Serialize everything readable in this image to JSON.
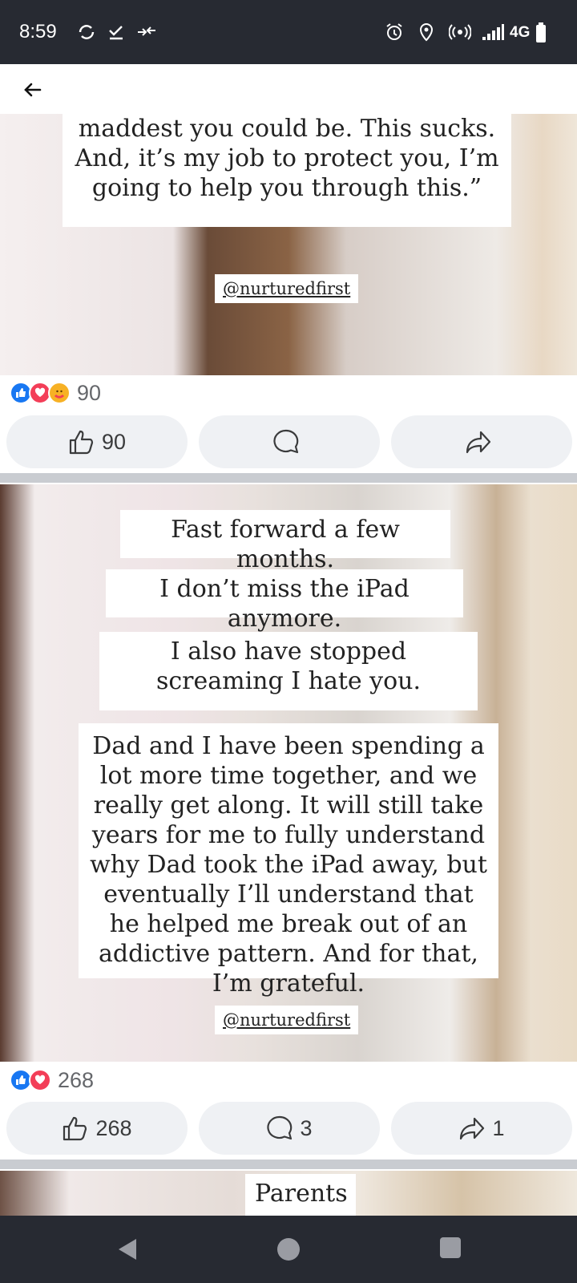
{
  "status": {
    "time": "8:59",
    "network": "4G"
  },
  "post1": {
    "lines": "maddest you could be. This sucks. And, it’s my job to protect you, I’m going to help you through this.”",
    "handle": "@nurturedfirst",
    "reaction_count": "90",
    "like_count": "90",
    "comment_count": "",
    "share_count": ""
  },
  "post2": {
    "box1": "Fast forward a few months.",
    "box2": "I don’t miss the iPad anymore.",
    "box3": "I also have stopped screaming I hate you.",
    "box4": "Dad and I have been spending a lot more time together, and we really get along. It will still take years for me to fully understand why Dad took the iPad away, but eventually I’ll understand that he helped me break out of an addictive pattern. And for that, I’m grateful.",
    "handle": "@nurturedfirst",
    "reaction_count": "268",
    "like_count": "268",
    "comment_count": "3",
    "share_count": "1"
  },
  "post3": {
    "box1": "Parents"
  },
  "colors": {
    "like_blue": "#1877f2",
    "love_red": "#f33e58",
    "care_yellow": "#f7b125",
    "statusbar": "#272a32"
  }
}
